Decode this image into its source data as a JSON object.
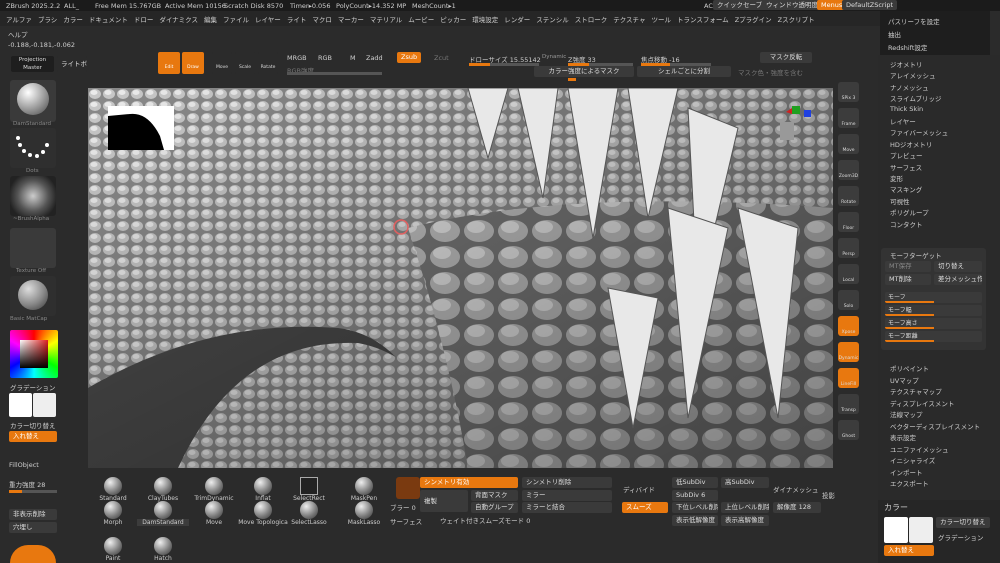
{
  "title_bar": {
    "app": "ZBrush 2025.2.2",
    "doc": "ALL_",
    "free_mem": "Free Mem 15.767GB",
    "active_mem": "Active Mem 10156",
    "scratch": "Scratch Disk 8570",
    "timer": "Timer▸0.056",
    "poly": "PolyCount▸14.352 MP",
    "mesh": "MeshCount▸1",
    "ac": "AC",
    "quicksave": "クイックセーブ",
    "transparency": "ウィンドウ透明度",
    "menus": "Menus",
    "script": "DefaultZScript"
  },
  "menu_bar": [
    "アルファ",
    "ブラシ",
    "カラー",
    "ドキュメント",
    "ドロー",
    "ダイナミクス",
    "編集",
    "ファイル",
    "レイヤー",
    "ライト",
    "マクロ",
    "マーカー",
    "マテリアル",
    "ムービー",
    "ピッカー",
    "環境設定",
    "レンダー",
    "ステンシル",
    "ストローク",
    "テクスチャ",
    "ツール",
    "トランスフォーム",
    "Zプラグイン",
    "Zスクリプト"
  ],
  "help": "ヘルプ",
  "coords": "-0.188,-0.181,-0.062",
  "left": {
    "projection": "Projection Master",
    "lightbox": "ライトボックス",
    "brush": "DamStandard",
    "stroke": "Dots",
    "alpha": "~BrushAlpha",
    "texture": "Texture Off",
    "material": "Basic MatCap",
    "gradient": "グラデーション",
    "swap": "カラー切り替え",
    "swap2": "入れ替え",
    "fill": "FillObject",
    "gravity": "重力強度 28",
    "sym": "非表示削除",
    "hide": "穴埋し"
  },
  "tools": {
    "edit": "Edit",
    "draw": "Draw",
    "move": "Move",
    "scale": "Scale",
    "rotate": "Rotate",
    "mrgb": "MRGB",
    "rgb": "RGB",
    "m": "M",
    "zadd": "Zadd",
    "zsub": "Zsub",
    "zcut": "Zcut",
    "rgb_int": "RGB強度",
    "z_int": "Z強度 33",
    "drawsize": "ドローサイズ 15.55142",
    "dynamic": "Dynamic",
    "focal": "焦点移動 -16",
    "mask_inv": "マスク反転",
    "mask_by_color": "カラー強度によるマスク",
    "split": "シェルごとに分割",
    "mask_color": "マスク色・強度を含む"
  },
  "right_icons": [
    "SPix 3",
    "Frame",
    "Move",
    "Zoom3D",
    "Rotate",
    "Floor",
    "Persp",
    "Local",
    "Solo",
    "Xpose",
    "Dynamic",
    "LineFill",
    "Transp",
    "Ghost"
  ],
  "right_menu": [
    "ジオメトリ",
    "アレイメッシュ",
    "ナノメッシュ",
    "スライムブリッジ",
    "Thick Skin",
    "レイヤー",
    "ファイバーメッシュ",
    "HDジオメトリ",
    "プレビュー",
    "サーフェス",
    "変形",
    "マスキング",
    "可視性",
    "ポリグループ",
    "コンタクト"
  ],
  "morph": {
    "title": "モーフターゲット",
    "store": "MT保存",
    "switch": "切り替え",
    "delete": "MT削除",
    "diff": "差分メッシュ作成",
    "morph": "モーフ",
    "dist": "モーフ幅",
    "height": "モーフ高さ",
    "pos": "モーフ距離",
    "smooth": "モーフ段影"
  },
  "right_menu2": [
    "ポリペイント",
    "UVマップ",
    "テクスチャマップ",
    "ディスプレイスメント",
    "法線マップ",
    "ベクターディスプレイスメント",
    "表示設定",
    "ユニファイメッシュ",
    "イニシャライズ",
    "インポート",
    "エクスポート"
  ],
  "top_right": {
    "a": "パスリーフを設定",
    "b": "抽出",
    "c": "Redshift設定"
  },
  "color_panel": {
    "title": "カラー",
    "swap": "カラー切り替え",
    "grad": "グラデーション",
    "exchange": "入れ替え"
  },
  "brushes": [
    "Standard",
    "ClayTubes",
    "TrimDynamic",
    "Inflat",
    "SelectRect",
    "MaskPen",
    "Morph",
    "DamStandard",
    "Move",
    "Move Topologica",
    "SelectLasso",
    "MaskLasso",
    "Paint",
    "Hatch"
  ],
  "bottom": {
    "sym": "シンメトリ有効",
    "symdel": "シンメトリ削除",
    "divide": "ディバイド",
    "lowsub": "低SubDiv",
    "delsub": "高SubDiv",
    "dyn": "ダイナメッシュ",
    "proj": "投影",
    "blur": "ブラー 0",
    "surface": "サーフェス",
    "back": "背面マスク",
    "mirror": "ミラー",
    "subdiv": "SubDiv 6",
    "down": "下位レベル削除",
    "up": "上位レベル削除",
    "res": "解像度 128",
    "dup": "複製",
    "auto": "自動グループ",
    "mirror_weld": "ミラーと結合",
    "smooth": "スムーズ",
    "show_low": "表示低解像度",
    "show_high": "表示高解像度",
    "weighted": "ウェイト付きスムーズモード 0"
  }
}
